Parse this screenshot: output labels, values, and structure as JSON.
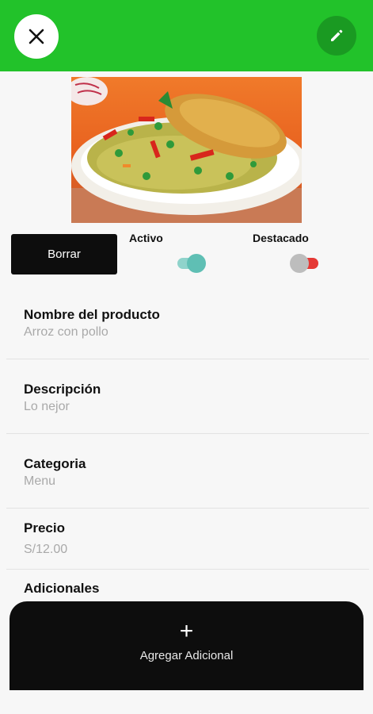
{
  "header": {
    "close_icon": "close-icon",
    "edit_icon": "pencil-icon",
    "bar_color": "#22c22a",
    "edit_color": "#1a9a22"
  },
  "product_image": "arroz-con-pollo-photo",
  "actions": {
    "delete_label": "Borrar",
    "active_label": "Activo",
    "active_on": true,
    "active_color": "#5fbfb4",
    "featured_label": "Destacado",
    "featured_on": false,
    "featured_color": "#e53935"
  },
  "fields": [
    {
      "label": "Nombre del producto",
      "value": "Arroz con pollo"
    },
    {
      "label": "Descripción",
      "value": "Lo nejor"
    },
    {
      "label": "Categoria",
      "value": "Menu"
    },
    {
      "label": "Precio",
      "value": "S/12.00"
    }
  ],
  "additionals": {
    "label": "Adicionales",
    "add_icon": "plus-icon",
    "add_label": "Agregar Adicional"
  }
}
